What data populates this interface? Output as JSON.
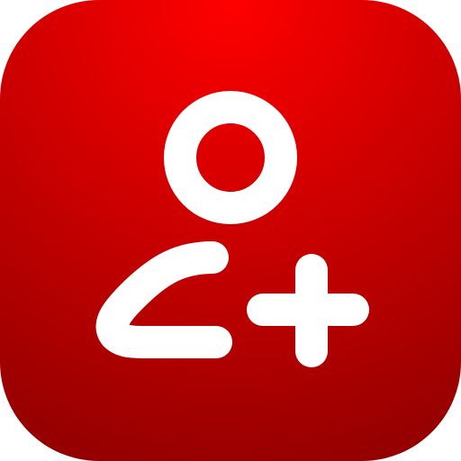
{
  "icon": {
    "name": "add-user-icon",
    "colors": {
      "gradient_top": "#ff0000",
      "gradient_bottom": "#8f0000",
      "glyph": "#ffffff"
    }
  }
}
